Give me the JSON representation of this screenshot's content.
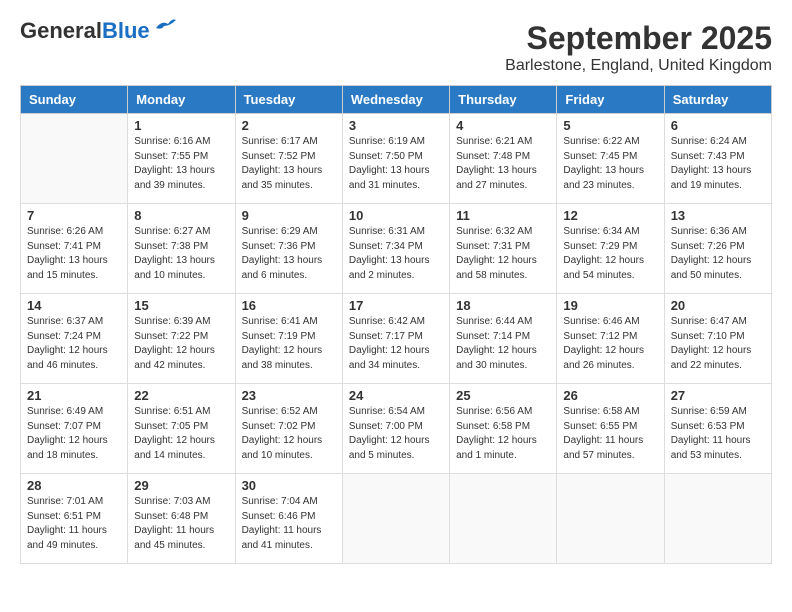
{
  "header": {
    "logo_general": "General",
    "logo_blue": "Blue",
    "month_year": "September 2025",
    "location": "Barlestone, England, United Kingdom"
  },
  "days_of_week": [
    "Sunday",
    "Monday",
    "Tuesday",
    "Wednesday",
    "Thursday",
    "Friday",
    "Saturday"
  ],
  "weeks": [
    [
      {
        "num": "",
        "sunrise": "",
        "sunset": "",
        "daylight": ""
      },
      {
        "num": "1",
        "sunrise": "Sunrise: 6:16 AM",
        "sunset": "Sunset: 7:55 PM",
        "daylight": "Daylight: 13 hours and 39 minutes."
      },
      {
        "num": "2",
        "sunrise": "Sunrise: 6:17 AM",
        "sunset": "Sunset: 7:52 PM",
        "daylight": "Daylight: 13 hours and 35 minutes."
      },
      {
        "num": "3",
        "sunrise": "Sunrise: 6:19 AM",
        "sunset": "Sunset: 7:50 PM",
        "daylight": "Daylight: 13 hours and 31 minutes."
      },
      {
        "num": "4",
        "sunrise": "Sunrise: 6:21 AM",
        "sunset": "Sunset: 7:48 PM",
        "daylight": "Daylight: 13 hours and 27 minutes."
      },
      {
        "num": "5",
        "sunrise": "Sunrise: 6:22 AM",
        "sunset": "Sunset: 7:45 PM",
        "daylight": "Daylight: 13 hours and 23 minutes."
      },
      {
        "num": "6",
        "sunrise": "Sunrise: 6:24 AM",
        "sunset": "Sunset: 7:43 PM",
        "daylight": "Daylight: 13 hours and 19 minutes."
      }
    ],
    [
      {
        "num": "7",
        "sunrise": "Sunrise: 6:26 AM",
        "sunset": "Sunset: 7:41 PM",
        "daylight": "Daylight: 13 hours and 15 minutes."
      },
      {
        "num": "8",
        "sunrise": "Sunrise: 6:27 AM",
        "sunset": "Sunset: 7:38 PM",
        "daylight": "Daylight: 13 hours and 10 minutes."
      },
      {
        "num": "9",
        "sunrise": "Sunrise: 6:29 AM",
        "sunset": "Sunset: 7:36 PM",
        "daylight": "Daylight: 13 hours and 6 minutes."
      },
      {
        "num": "10",
        "sunrise": "Sunrise: 6:31 AM",
        "sunset": "Sunset: 7:34 PM",
        "daylight": "Daylight: 13 hours and 2 minutes."
      },
      {
        "num": "11",
        "sunrise": "Sunrise: 6:32 AM",
        "sunset": "Sunset: 7:31 PM",
        "daylight": "Daylight: 12 hours and 58 minutes."
      },
      {
        "num": "12",
        "sunrise": "Sunrise: 6:34 AM",
        "sunset": "Sunset: 7:29 PM",
        "daylight": "Daylight: 12 hours and 54 minutes."
      },
      {
        "num": "13",
        "sunrise": "Sunrise: 6:36 AM",
        "sunset": "Sunset: 7:26 PM",
        "daylight": "Daylight: 12 hours and 50 minutes."
      }
    ],
    [
      {
        "num": "14",
        "sunrise": "Sunrise: 6:37 AM",
        "sunset": "Sunset: 7:24 PM",
        "daylight": "Daylight: 12 hours and 46 minutes."
      },
      {
        "num": "15",
        "sunrise": "Sunrise: 6:39 AM",
        "sunset": "Sunset: 7:22 PM",
        "daylight": "Daylight: 12 hours and 42 minutes."
      },
      {
        "num": "16",
        "sunrise": "Sunrise: 6:41 AM",
        "sunset": "Sunset: 7:19 PM",
        "daylight": "Daylight: 12 hours and 38 minutes."
      },
      {
        "num": "17",
        "sunrise": "Sunrise: 6:42 AM",
        "sunset": "Sunset: 7:17 PM",
        "daylight": "Daylight: 12 hours and 34 minutes."
      },
      {
        "num": "18",
        "sunrise": "Sunrise: 6:44 AM",
        "sunset": "Sunset: 7:14 PM",
        "daylight": "Daylight: 12 hours and 30 minutes."
      },
      {
        "num": "19",
        "sunrise": "Sunrise: 6:46 AM",
        "sunset": "Sunset: 7:12 PM",
        "daylight": "Daylight: 12 hours and 26 minutes."
      },
      {
        "num": "20",
        "sunrise": "Sunrise: 6:47 AM",
        "sunset": "Sunset: 7:10 PM",
        "daylight": "Daylight: 12 hours and 22 minutes."
      }
    ],
    [
      {
        "num": "21",
        "sunrise": "Sunrise: 6:49 AM",
        "sunset": "Sunset: 7:07 PM",
        "daylight": "Daylight: 12 hours and 18 minutes."
      },
      {
        "num": "22",
        "sunrise": "Sunrise: 6:51 AM",
        "sunset": "Sunset: 7:05 PM",
        "daylight": "Daylight: 12 hours and 14 minutes."
      },
      {
        "num": "23",
        "sunrise": "Sunrise: 6:52 AM",
        "sunset": "Sunset: 7:02 PM",
        "daylight": "Daylight: 12 hours and 10 minutes."
      },
      {
        "num": "24",
        "sunrise": "Sunrise: 6:54 AM",
        "sunset": "Sunset: 7:00 PM",
        "daylight": "Daylight: 12 hours and 5 minutes."
      },
      {
        "num": "25",
        "sunrise": "Sunrise: 6:56 AM",
        "sunset": "Sunset: 6:58 PM",
        "daylight": "Daylight: 12 hours and 1 minute."
      },
      {
        "num": "26",
        "sunrise": "Sunrise: 6:58 AM",
        "sunset": "Sunset: 6:55 PM",
        "daylight": "Daylight: 11 hours and 57 minutes."
      },
      {
        "num": "27",
        "sunrise": "Sunrise: 6:59 AM",
        "sunset": "Sunset: 6:53 PM",
        "daylight": "Daylight: 11 hours and 53 minutes."
      }
    ],
    [
      {
        "num": "28",
        "sunrise": "Sunrise: 7:01 AM",
        "sunset": "Sunset: 6:51 PM",
        "daylight": "Daylight: 11 hours and 49 minutes."
      },
      {
        "num": "29",
        "sunrise": "Sunrise: 7:03 AM",
        "sunset": "Sunset: 6:48 PM",
        "daylight": "Daylight: 11 hours and 45 minutes."
      },
      {
        "num": "30",
        "sunrise": "Sunrise: 7:04 AM",
        "sunset": "Sunset: 6:46 PM",
        "daylight": "Daylight: 11 hours and 41 minutes."
      },
      {
        "num": "",
        "sunrise": "",
        "sunset": "",
        "daylight": ""
      },
      {
        "num": "",
        "sunrise": "",
        "sunset": "",
        "daylight": ""
      },
      {
        "num": "",
        "sunrise": "",
        "sunset": "",
        "daylight": ""
      },
      {
        "num": "",
        "sunrise": "",
        "sunset": "",
        "daylight": ""
      }
    ]
  ]
}
